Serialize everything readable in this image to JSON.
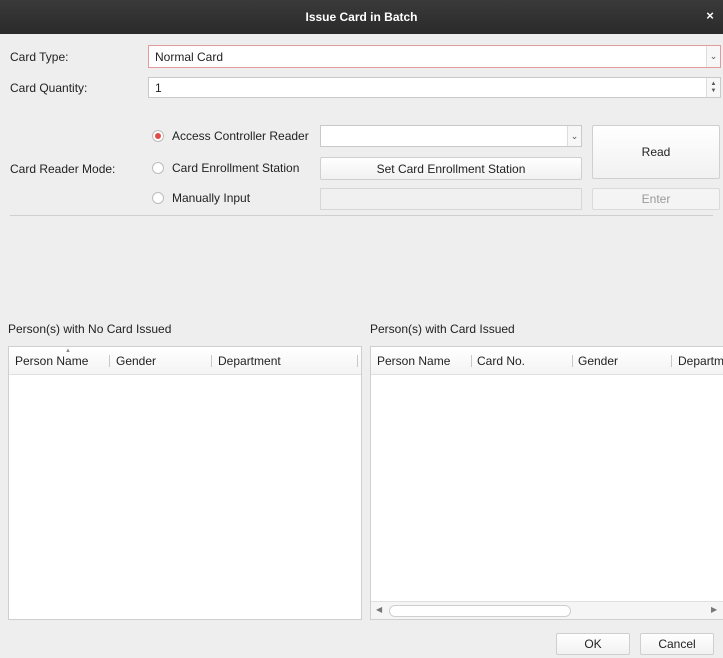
{
  "window": {
    "title": "Issue Card in Batch",
    "close_glyph": "×"
  },
  "card_type": {
    "label": "Card Type:",
    "value": "Normal Card"
  },
  "card_quantity": {
    "label": "Card Quantity:",
    "value": "1"
  },
  "card_reader": {
    "label": "Card Reader Mode:",
    "options": [
      {
        "label": "Access Controller Reader",
        "selected": true
      },
      {
        "label": "Card Enrollment Station",
        "selected": false
      },
      {
        "label": "Manually Input",
        "selected": false
      }
    ],
    "reader_select_value": "",
    "set_station_button": "Set Card Enrollment Station",
    "read_button": "Read",
    "enter_button": "Enter",
    "manual_input_value": ""
  },
  "no_card_panel": {
    "title": "Person(s) with No Card Issued",
    "columns": [
      "Person Name",
      "Gender",
      "Department"
    ],
    "rows": []
  },
  "card_panel": {
    "title": "Person(s) with Card Issued",
    "columns": [
      "Person Name",
      "Card No.",
      "Gender",
      "Departm"
    ],
    "rows": []
  },
  "footer": {
    "ok_button": "OK",
    "cancel_button": "Cancel"
  },
  "colors": {
    "titlebar": "#2f2f2f",
    "radio_selected": "#e24b4b",
    "highlight_border": "#e29a9a",
    "dialog_bg": "#eeeeee"
  }
}
